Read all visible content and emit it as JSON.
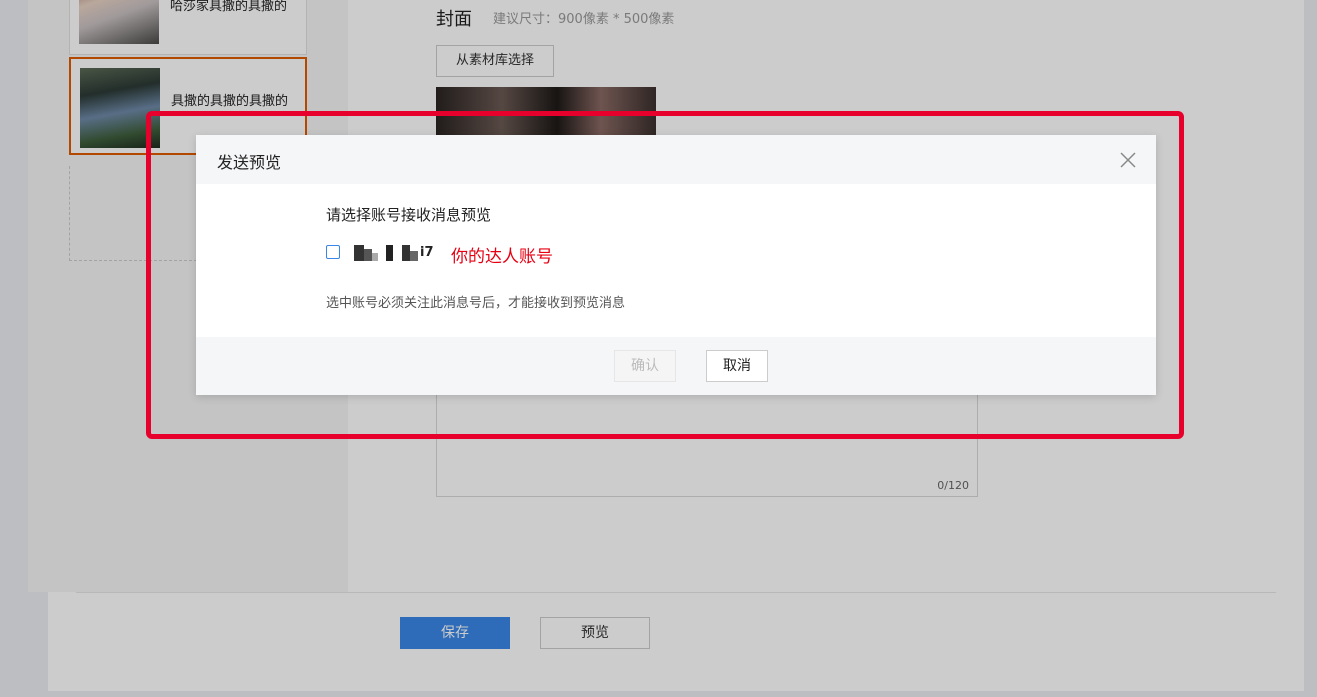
{
  "articles": [
    {
      "title": "哈莎家具撒的具撒的"
    },
    {
      "title": "具撒的具撒的具撒的"
    }
  ],
  "cover": {
    "label": "封面",
    "hint": "建议尺寸：900像素 * 500像素",
    "pick_label": "从素材库选择"
  },
  "digest": {
    "counter": "0/120"
  },
  "footer": {
    "save_label": "保存",
    "preview_label": "预览"
  },
  "modal": {
    "title": "发送预览",
    "prompt": "请选择账号接收消息预览",
    "account_visible_suffix": "i7",
    "annotation": "你的达人账号",
    "note": "选中账号必须关注此消息号后，才能接收到预览消息",
    "confirm_label": "确认",
    "cancel_label": "取消"
  },
  "colors": {
    "accent": "#3a86e8",
    "selected_border": "#e05a00",
    "highlight": "#e8002d"
  },
  "icons": {
    "close": "close-icon"
  }
}
